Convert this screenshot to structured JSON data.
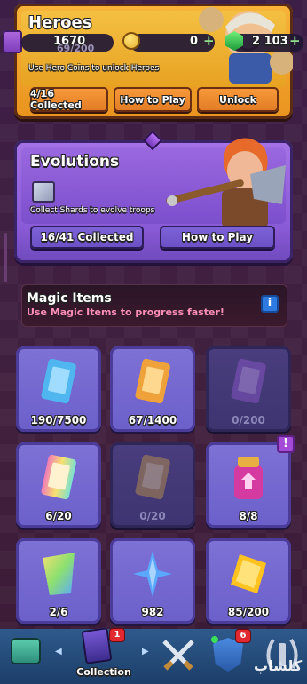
{
  "heroes": {
    "title": "Heroes",
    "hero_coins": "1670",
    "hero_coins_sub": "69/200",
    "gold": "0",
    "gems": "2 103",
    "subtitle": "Use Hero Coins to unlock Heroes",
    "collected": "4/16 Collected",
    "how_to_play": "How to Play",
    "unlock": "Unlock"
  },
  "evolutions": {
    "title": "Evolutions",
    "subtitle": "Collect Shards to evolve troops",
    "collected": "16/41 Collected",
    "how_to_play": "How to Play"
  },
  "magic": {
    "title": "Magic Items",
    "subtitle": "Use Magic Items to progress faster!",
    "info_label": "i"
  },
  "items": [
    {
      "count": "190/7500",
      "icon": "common-book-icon",
      "color": "#4fb6f0"
    },
    {
      "count": "67/1400",
      "icon": "rare-book-icon",
      "color": "#f0a23a"
    },
    {
      "count": "0/200",
      "icon": "epic-book-icon",
      "color": "#8a56c8"
    },
    {
      "count": "6/20",
      "icon": "legendary-book-icon",
      "color": "#f07ab8"
    },
    {
      "count": "0/20",
      "icon": "champion-book-icon",
      "color": "#b8904a"
    },
    {
      "count": "8/8",
      "icon": "elixir-potion-icon",
      "color": "#d43aa0"
    },
    {
      "count": "2/6",
      "icon": "wild-shard-icon",
      "color": "#8ce070"
    },
    {
      "count": "982",
      "icon": "star-shard-icon",
      "color": "#5aa8ff"
    },
    {
      "count": "85/200",
      "icon": "gold-shard-icon",
      "color": "#ffc21f"
    }
  ],
  "item_alert": "!",
  "nav": {
    "collection_label": "Collection",
    "collection_badge": "1",
    "clan_badge": "6",
    "watermark": "کلشاپ"
  }
}
